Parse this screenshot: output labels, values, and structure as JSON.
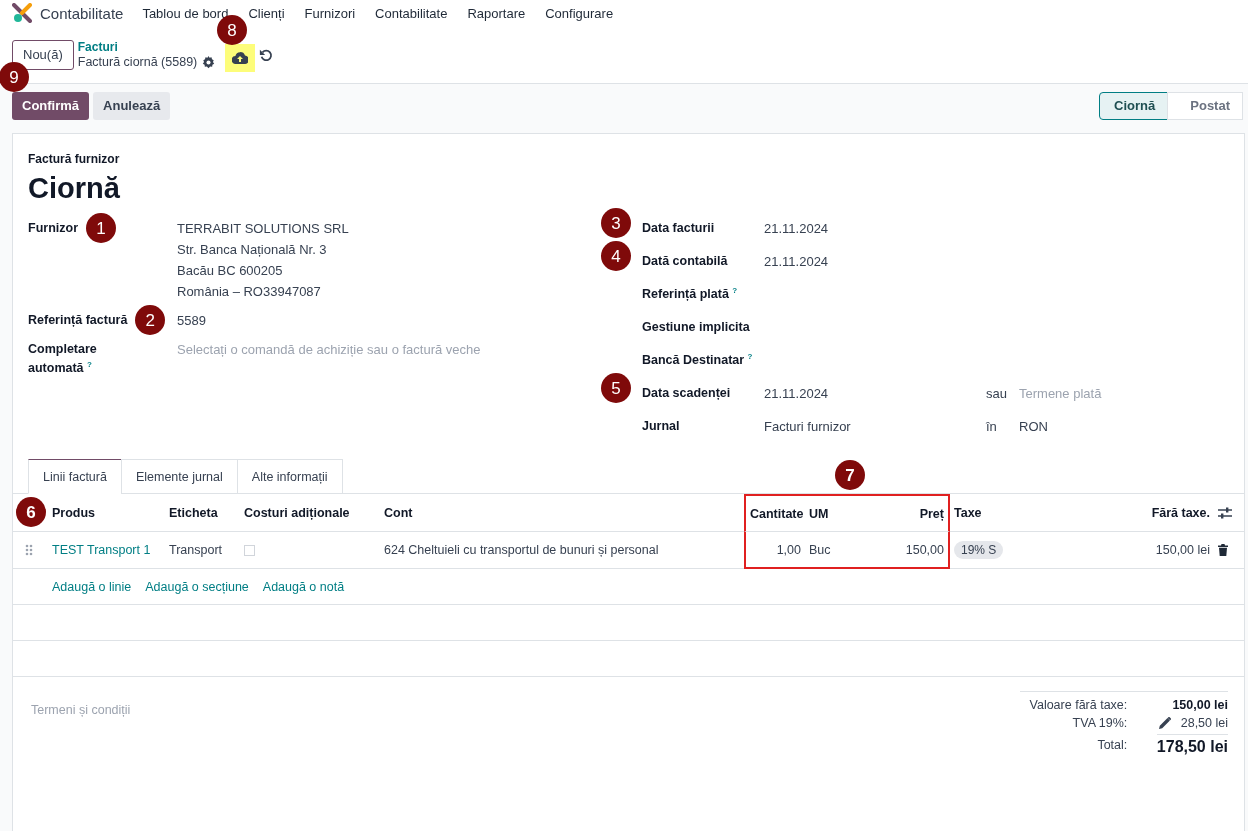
{
  "app": {
    "name": "Contabilitate",
    "menu": [
      "Tablou de bord",
      "Clienți",
      "Furnizori",
      "Contabilitate",
      "Raportare",
      "Configurare"
    ]
  },
  "control_panel": {
    "new_button": "Nou(ă)",
    "new_marker": "9",
    "breadcrumb": "Facturi",
    "record": "Factură ciornă (5589)",
    "save_highlighted": true,
    "save_marker": "8"
  },
  "actions": [
    {
      "label": "Confirmă",
      "kind": "primary"
    },
    {
      "label": "Anulează",
      "kind": "secondary"
    }
  ],
  "status": [
    {
      "label": "Ciornă",
      "selected": true
    },
    {
      "label": "Postat",
      "selected": false
    }
  ],
  "form": {
    "type_label": "Factură furnizor",
    "title": "Ciornă",
    "left_fields": [
      {
        "label": "Furnizor",
        "marker": "1",
        "lines": [
          "TERRABIT SOLUTIONS SRL",
          "Str. Banca Națională Nr. 3",
          "Bacău BC 600205",
          "România – RO33947087"
        ]
      },
      {
        "label": "Referință factură",
        "marker": "2",
        "lines": [
          "5589"
        ]
      },
      {
        "label": "Completare automată",
        "help": "?",
        "placeholder": "Selectați o comandă de achiziție sau o factură veche"
      }
    ],
    "right_fields": [
      {
        "label": "Data facturii",
        "marker": "3",
        "value": "21.11.2024"
      },
      {
        "label": "Dată contabilă",
        "marker": "4",
        "value": "21.11.2024"
      },
      {
        "label": "Referință plată",
        "help": "?"
      },
      {
        "label": "Gestiune implicita"
      },
      {
        "label": "Bancă Destinatar",
        "help": "?"
      },
      {
        "label": "Data scadenței",
        "marker": "5",
        "value": "21.11.2024",
        "joiner": "sau",
        "extra_placeholder": "Termene plată"
      },
      {
        "label": "Jurnal",
        "value": "Facturi furnizor",
        "joiner": "în",
        "extra": "RON"
      }
    ]
  },
  "tabs": [
    {
      "label": "Linii factură",
      "selected": true
    },
    {
      "label": "Elemente jurnal",
      "selected": false
    },
    {
      "label": "Alte informații",
      "selected": false
    }
  ],
  "table": {
    "marker": "6",
    "highlight_marker": "7",
    "columns": [
      {
        "label": "Produs",
        "kind": "text",
        "highlighted": false
      },
      {
        "label": "Eticheta",
        "kind": "text",
        "highlighted": false
      },
      {
        "label": "Costuri adiționale",
        "kind": "text",
        "highlighted": false
      },
      {
        "label": "Cont",
        "kind": "text",
        "highlighted": false
      },
      {
        "label": "Cantitate",
        "kind": "number",
        "highlighted": true
      },
      {
        "label": "UM",
        "kind": "text",
        "highlighted": true
      },
      {
        "label": "Preț",
        "kind": "number",
        "highlighted": true
      },
      {
        "label": "Taxe",
        "kind": "text",
        "highlighted": false
      },
      {
        "label": "Fără taxe.",
        "kind": "number",
        "highlighted": false
      }
    ],
    "rows": [
      {
        "product": "TEST Transport 1",
        "label": "Transport",
        "additional_costs": false,
        "account": "624 Cheltuieli cu transportul de bunuri și personal",
        "quantity": "1,00",
        "uom": "Buc",
        "price": "150,00",
        "tax": "19% S",
        "subtotal": "150,00 lei"
      }
    ],
    "add_links": [
      "Adaugă o linie",
      "Adaugă o secțiune",
      "Adaugă o notă"
    ]
  },
  "terms_placeholder": "Termeni și condiții",
  "totals": [
    {
      "label": "Valoare fără taxe:",
      "value": "150,00 lei",
      "kind": "untaxed"
    },
    {
      "label": "TVA 19%:",
      "value": "28,50 lei",
      "kind": "tax"
    },
    {
      "label": "Total:",
      "value": "178,50 lei",
      "kind": "total"
    }
  ]
}
